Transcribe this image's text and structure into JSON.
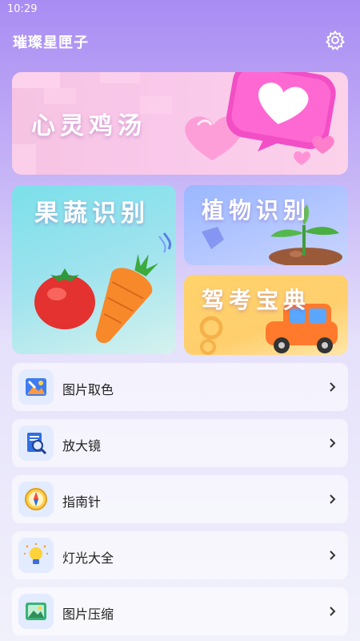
{
  "status": {
    "time": "10:29"
  },
  "header": {
    "title": "璀璨星匣子"
  },
  "cards": {
    "banner": "心灵鸡汤",
    "fruit": "果蔬识别",
    "plant": "植物识别",
    "driver": "驾考宝典"
  },
  "tools": [
    {
      "label": "图片取色",
      "icon": "color-picker-icon"
    },
    {
      "label": "放大镜",
      "icon": "magnifier-icon"
    },
    {
      "label": "指南针",
      "icon": "compass-icon"
    },
    {
      "label": "灯光大全",
      "icon": "lightbulb-icon"
    },
    {
      "label": "图片压缩",
      "icon": "image-compress-icon"
    }
  ],
  "colors": {
    "accent": "#a98cf3",
    "card_text": "#ffffff"
  }
}
